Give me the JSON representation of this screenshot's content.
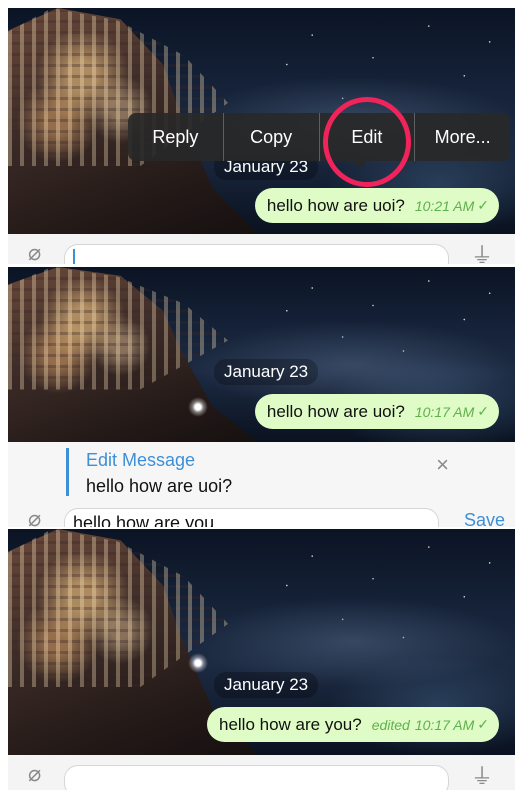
{
  "panel1": {
    "date": "January 23",
    "message": {
      "text": "hello how are uoi?",
      "time": "10:21 AM",
      "status": "✓"
    },
    "context_menu": [
      "Reply",
      "Copy",
      "Edit",
      "More..."
    ]
  },
  "panel2": {
    "date": "January 23",
    "message": {
      "text": "hello how are uoi?",
      "time": "10:17 AM",
      "status": "✓"
    },
    "edit_header": {
      "title": "Edit Message",
      "preview": "hello how are uoi?",
      "close_icon": "×"
    },
    "input": {
      "value": "hello how are you",
      "send_label": "Save"
    }
  },
  "panel3": {
    "date": "January 23",
    "message": {
      "text": "hello how are you?",
      "edited_label": "edited",
      "time": "10:17 AM",
      "status": "✓"
    }
  },
  "colors": {
    "bubble": "#dffbc6",
    "accent": "#3d8fd8",
    "highlight": "#f0245b",
    "time": "#5fb14d"
  },
  "icons": {
    "attach": "paperclip-icon",
    "mic": "microphone-icon",
    "close": "close-icon"
  }
}
